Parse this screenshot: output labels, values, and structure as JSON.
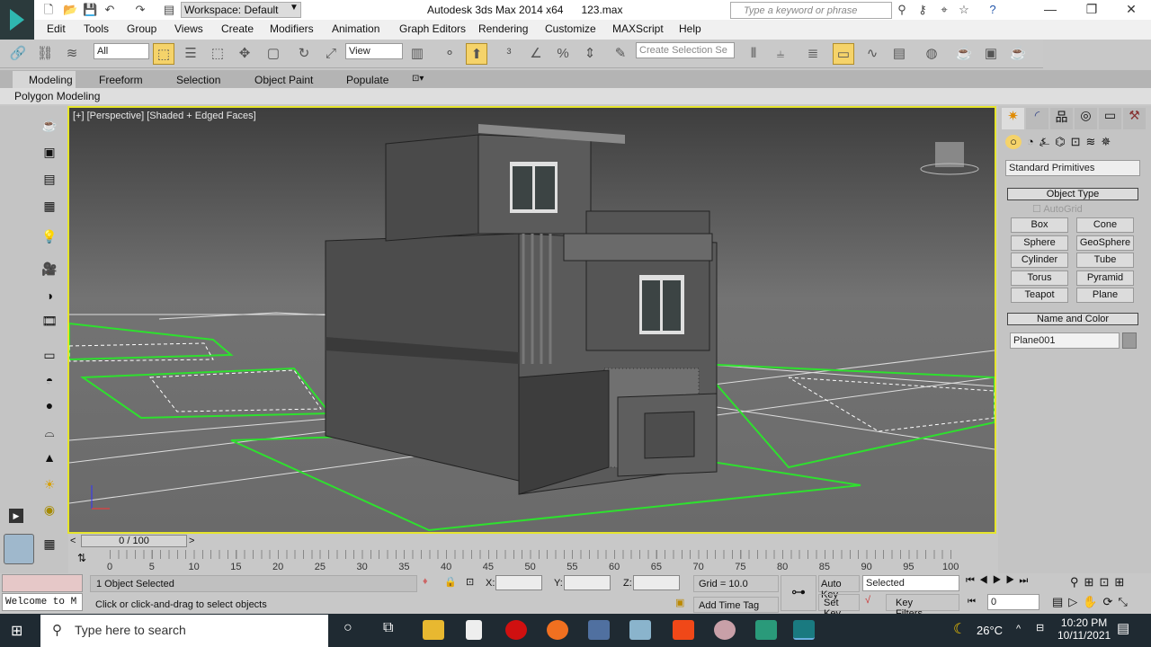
{
  "title": {
    "app": "Autodesk 3ds Max  2014 x64",
    "file": "123.max",
    "workspace": "Workspace: Default",
    "search_placeholder": "Type a keyword or phrase"
  },
  "menu": [
    "Edit",
    "Tools",
    "Group",
    "Views",
    "Create",
    "Modifiers",
    "Animation",
    "Graph Editors",
    "Rendering",
    "Customize",
    "MAXScript",
    "Help"
  ],
  "toolbar": {
    "selection_filter": "All",
    "ref_coord": "View",
    "named_selection": "Create Selection Se"
  },
  "ribbon": {
    "tabs": [
      "Modeling",
      "Freeform",
      "Selection",
      "Object Paint",
      "Populate"
    ],
    "panel": "Polygon Modeling"
  },
  "viewport": {
    "label": "[+] [Perspective] [Shaded + Edged Faces]"
  },
  "command_panel": {
    "category": "Standard Primitives",
    "object_type_title": "Object Type",
    "autogrid": "AutoGrid",
    "buttons": [
      "Box",
      "Cone",
      "Sphere",
      "GeoSphere",
      "Cylinder",
      "Tube",
      "Torus",
      "Pyramid",
      "Teapot",
      "Plane"
    ],
    "name_color_title": "Name and Color",
    "object_name": "Plane001"
  },
  "timeline": {
    "frame": "0 / 100",
    "ticks": [
      "0",
      "5",
      "10",
      "15",
      "20",
      "25",
      "30",
      "35",
      "40",
      "45",
      "50",
      "55",
      "60",
      "65",
      "70",
      "75",
      "80",
      "85",
      "90",
      "95",
      "100"
    ]
  },
  "status": {
    "selected": "1 Object Selected",
    "prompt": "Click or click-and-drag to select objects",
    "script": "Welcome to M",
    "x_label": "X:",
    "y_label": "Y:",
    "z_label": "Z:",
    "grid": "Grid = 10.0",
    "add_time_tag": "Add Time Tag",
    "auto_key": "Auto Key",
    "set_key": "Set Key",
    "key_mode": "Selected",
    "key_filters": "Key Filters...",
    "current_frame": "0"
  },
  "taskbar": {
    "search": "Type here to search",
    "weather": "26°C",
    "time": "10:20 PM",
    "date": "10/11/2021"
  }
}
